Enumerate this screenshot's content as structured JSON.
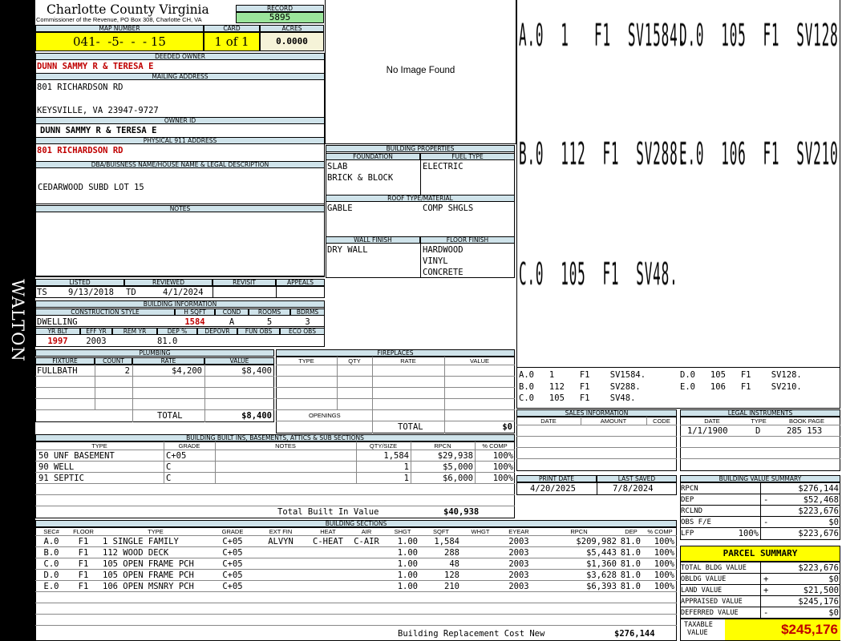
{
  "header": {
    "county": "Charlotte County Virginia",
    "commissioner": "Commissioner of the Revenue, PO Box 308, Charlotte CH, VA",
    "record_label": "RECORD",
    "record": "5895",
    "map_label": "MAP NUMBER",
    "map_number": "041-  -5-  -  - 15",
    "card_label": "CARD",
    "card": "1 of 1",
    "acres_label": "ACRES",
    "acres": "0.0000"
  },
  "district": "WALTON",
  "owner": {
    "deeded_label": "DEEDED OWNER",
    "deeded": "DUNN SAMMY R & TERESA E",
    "mailing_label": "MAILING ADDRESS",
    "mailing_line1": "801 RICHARDSON RD",
    "mailing_line2": "KEYSVILLE, VA 23947-9727",
    "owner_id_label": "OWNER ID",
    "owner_id": "DUNN SAMMY R & TERESA E",
    "physical_label": "PHYSICAL 911 ADDRESS",
    "physical": "801 RICHARDSON RD",
    "dba_label": "DBA/BUISNESS NAME/HOUSE NAME & LEGAL DESCRIPTION",
    "legal": "CEDARWOOD SUBD LOT 15",
    "notes_label": "NOTES"
  },
  "image": {
    "no_image": "No Image Found"
  },
  "building_props": {
    "title": "BUILDING PROPERTIES",
    "foundation_label": "FOUNDATION",
    "foundation": [
      "SLAB",
      "BRICK & BLOCK"
    ],
    "fuel_label": "FUEL TYPE",
    "fuel": "ELECTRIC",
    "roof_label": "ROOF TYPE/MATERIAL",
    "roof_type": "GABLE",
    "roof_material": "COMP SHGLS",
    "wall_label": "WALL FINISH",
    "wall": "DRY WALL",
    "floor_label": "FLOOR FINISH",
    "floor": [
      "HARDWOOD",
      "VINYL",
      "CONCRETE"
    ]
  },
  "sketch": {
    "big_rows": [
      [
        "A.0  1   F1  SV1584.",
        "D.0  105  F1  SV128."
      ],
      [
        "B.0  112  F1  SV288.",
        "E.0  106  F1  SV210."
      ],
      [
        "C.0  105  F1  SV48.",
        ""
      ]
    ],
    "small_rows": [
      [
        "A.0   1     F1    SV1584.",
        "D.0   105   F1    SV128."
      ],
      [
        "B.0   112   F1    SV288.",
        "E.0   106   F1    SV210."
      ],
      [
        "C.0   105   F1    SV48.",
        ""
      ]
    ]
  },
  "listing": {
    "listed_label": "LISTED",
    "reviewed_label": "REVIEWED",
    "revisit_label": "REVISIT",
    "appeals_label": "APPEALS",
    "listed_by": "TS",
    "listed_date": "9/13/2018",
    "reviewed_by": "TD",
    "reviewed_date": "4/1/2024"
  },
  "building_info": {
    "title": "BUILDING INFORMATION",
    "style_label": "CONSTRUCTION STYLE",
    "hsqft_label": "H SQFT",
    "cond_label": "COND",
    "rooms_label": "ROOMS",
    "bdrms_label": "BDRMS",
    "style": "DWELLING",
    "hsqft": "1584",
    "cond": "A",
    "rooms": "5",
    "bdrms": "3",
    "yrblt_label": "YR BLT",
    "effyr_label": "EFF YR",
    "remyr_label": "REM YR",
    "dep_label": "DEP %",
    "depovr_label": "DEPOVR",
    "funobs_label": "FUN OBS",
    "ecoobs_label": "ECO OBS",
    "yrblt": "1997",
    "effyr": "2003",
    "dep": "81.0"
  },
  "plumbing": {
    "title": "PLUMBING",
    "headers": [
      "FIXTURE",
      "COUNT",
      "RATE",
      "VALUE"
    ],
    "rows": [
      [
        "FULLBATH",
        "2",
        "$4,200",
        "$8,400"
      ]
    ],
    "total_label": "TOTAL",
    "total": "$8,400"
  },
  "fireplaces": {
    "title": "FIREPLACES",
    "headers": [
      "TYPE",
      "QTY",
      "RATE",
      "VALUE"
    ],
    "openings_label": "OPENINGS",
    "total_label": "TOTAL",
    "total": "$0"
  },
  "sales": {
    "title": "SALES INFORMATION",
    "headers": [
      "DATE",
      "AMOUNT",
      "CODE"
    ]
  },
  "legal_instr": {
    "title": "LEGAL INSTRUMENTS",
    "headers": [
      "DATE",
      "TYPE",
      "BOOK PAGE"
    ],
    "rows": [
      [
        "1/1/1900",
        "D",
        "285 153"
      ]
    ]
  },
  "builtins": {
    "title": "BUILDING BUILT INS, BASEMENTS, ATTICS & SUB SECTIONS",
    "headers": [
      "TYPE",
      "GRADE",
      "NOTES",
      "QTY/SIZE",
      "RPCN",
      "% COMP"
    ],
    "rows": [
      [
        "50 UNF BASEMENT",
        "C+05",
        "",
        "1,584",
        "$29,938",
        "100%"
      ],
      [
        "90 WELL",
        "C",
        "",
        "1",
        "$5,000",
        "100%"
      ],
      [
        "91 SEPTIC",
        "C",
        "",
        "1",
        "$6,000",
        "100%"
      ]
    ],
    "total_label": "Total Built In Value",
    "total": "$40,938"
  },
  "print": {
    "print_label": "PRINT DATE",
    "saved_label": "LAST SAVED",
    "print_date": "4/20/2025",
    "saved_date": "7/8/2024"
  },
  "value_summary": {
    "title": "BUILDING VALUE SUMMARY",
    "rows": [
      [
        "RPCN",
        "",
        "$276,144"
      ],
      [
        "DEP",
        "-",
        "$52,468"
      ],
      [
        "RCLND",
        "",
        "$223,676"
      ],
      [
        "OBS F/E",
        "-",
        "$0"
      ],
      [
        "LFP",
        "100%",
        "$223,676"
      ]
    ]
  },
  "parcel": {
    "title": "PARCEL SUMMARY",
    "rows": [
      [
        "TOTAL BLDG VALUE",
        "",
        "$223,676"
      ],
      [
        "OBLDG VALUE",
        "+",
        "$0"
      ],
      [
        "LAND VALUE",
        "+",
        "$21,500"
      ],
      [
        "APPRAISED VALUE",
        "",
        "$245,176"
      ],
      [
        "DEFERRED VALUE",
        "-",
        "$0"
      ]
    ],
    "taxable_label1": "TAXABLE",
    "taxable_label2": "VALUE",
    "taxable": "$245,176"
  },
  "sections": {
    "title": "BUILDING SECTIONS",
    "headers": [
      "SEC#",
      "FLOOR",
      "TYPE",
      "GRADE",
      "EXT FIN",
      "HEAT",
      "AIR",
      "SHGT",
      "SQFT",
      "WHGT",
      "EYEAR",
      "RPCN",
      "DEP",
      "% COMP"
    ],
    "rows": [
      [
        "A.0",
        "F1",
        "1 SINGLE FAMILY",
        "C+05",
        "ALVYN",
        "C-HEAT",
        "C-AIR",
        "1.00",
        "1,584",
        "",
        "2003",
        "$209,982",
        "81.0",
        "100%"
      ],
      [
        "B.0",
        "F1",
        "112 WOOD DECK",
        "C+05",
        "",
        "",
        "",
        "1.00",
        "288",
        "",
        "2003",
        "$5,443",
        "81.0",
        "100%"
      ],
      [
        "C.0",
        "F1",
        "105 OPEN FRAME PCH",
        "C+05",
        "",
        "",
        "",
        "1.00",
        "48",
        "",
        "2003",
        "$1,360",
        "81.0",
        "100%"
      ],
      [
        "D.0",
        "F1",
        "105 OPEN FRAME PCH",
        "C+05",
        "",
        "",
        "",
        "1.00",
        "128",
        "",
        "2003",
        "$3,628",
        "81.0",
        "100%"
      ],
      [
        "E.0",
        "F1",
        "106 OPEN MSNRY PCH",
        "C+05",
        "",
        "",
        "",
        "1.00",
        "210",
        "",
        "2003",
        "$6,393",
        "81.0",
        "100%"
      ]
    ],
    "total_label": "Building Replacement Cost New",
    "total": "$276,144"
  }
}
